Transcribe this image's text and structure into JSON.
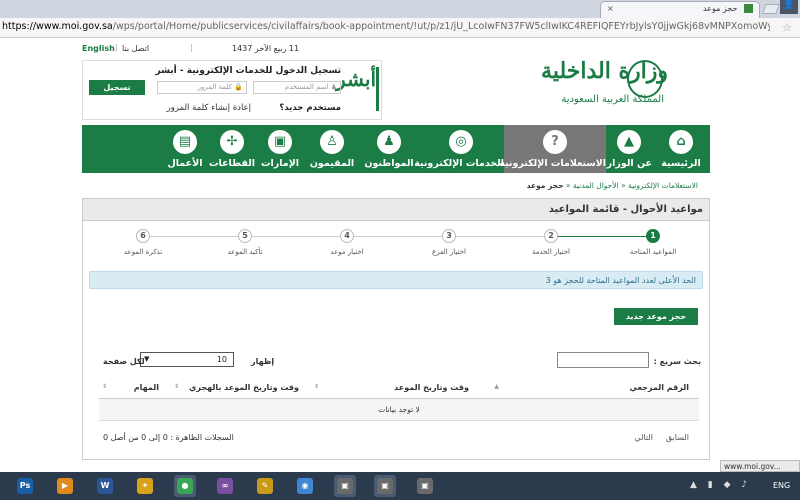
{
  "browser": {
    "tab_title": "حجز موعد",
    "tab_close": "×",
    "new_tab_button": "",
    "window_control": "👤",
    "url_domain": "https://www.moi.gov.sa",
    "url_path": "/wps/portal/Home/publicservices/civilaffairs/book-appointment/!ut/p/z1/jU_LcoIwFN37FW5clIwIKC4REFIQFEYrbJylsY0jjwGkj68vMNPXomoWycmc",
    "status_link": "www.moi.gov..."
  },
  "topbar": {
    "hijri_date": "11 ربيع الآخر 1437",
    "contact_link": "اتصل بنا",
    "english_link": "English"
  },
  "logo": {
    "title": "وزارة الداخلية",
    "subtitle": "المملكة العربية السعودية"
  },
  "login": {
    "absher_logo": "أبشر",
    "title": "تسجيل الدخول للخدمات الإلكترونية - أبشر",
    "username_placeholder": "اسم المستخدم",
    "password_placeholder": "كلمة المرور",
    "login_button": "تسجيل الدخول",
    "new_user_link": "مستخدم جديد؟",
    "reset_password_link": "إعادة إنشاء كلمة المرور"
  },
  "nav": {
    "items": [
      {
        "label": "الرئيسية",
        "icon": "home-icon",
        "glyph": "⌂"
      },
      {
        "label": "عن الوزارة",
        "icon": "ministry-icon",
        "glyph": "▲"
      },
      {
        "label": "الاستعلامات الإلكترونية",
        "icon": "inquiries-icon",
        "glyph": "?"
      },
      {
        "label": "الخدمات الإلكترونية",
        "icon": "globe-icon",
        "glyph": "◎"
      },
      {
        "label": "المواطنون",
        "icon": "citizen-icon",
        "glyph": "♟"
      },
      {
        "label": "المقيمون",
        "icon": "residents-icon",
        "glyph": "♙"
      },
      {
        "label": "الإمارات",
        "icon": "regions-icon",
        "glyph": "▣"
      },
      {
        "label": "القطاعات",
        "icon": "sectors-icon",
        "glyph": "✢"
      },
      {
        "label": "الأعمال",
        "icon": "business-icon",
        "glyph": "▤"
      }
    ]
  },
  "breadcrumb": {
    "item1": "الاستعلامات الإلكترونية",
    "item2": "الأحوال المدنية",
    "current": "حجز موعد",
    "sep": "«"
  },
  "panel": {
    "title": "مواعيد الأحوال - قائمة المواعيد",
    "steps": [
      {
        "num": "1",
        "label": "المواعيد المتاحة"
      },
      {
        "num": "2",
        "label": "اختيار الخدمة"
      },
      {
        "num": "3",
        "label": "اختيار الفرع"
      },
      {
        "num": "4",
        "label": "اختيار موعد"
      },
      {
        "num": "5",
        "label": "تأكيد الموعد"
      },
      {
        "num": "6",
        "label": "تذكرة الموعد"
      }
    ],
    "notice": "الحد الأعلى لعدد المواعيد المتاحة للحجز هو 3",
    "new_booking_button": "حجز موعد جديد",
    "quick_search_label": "بحث سريع :",
    "show_label": "إظهار",
    "page_size": "10",
    "per_page_label": "لكل صفحة",
    "columns": [
      "الرقم المرجعي",
      "وقت وتاريخ الموعد",
      "وقت وتاريخ الموعد بالهجري",
      "المهام"
    ],
    "empty_message": "لا توجد بيانات",
    "records_info": "السجلات الظاهرة : 0 إلى 0 من أصل 0",
    "next_label": "التالي",
    "prev_label": "السابق"
  },
  "taskbar": {
    "apps": [
      {
        "name": "photoshop-icon",
        "glyph": "Ps",
        "color": "#1b5ea8"
      },
      {
        "name": "media-player-icon",
        "glyph": "▶",
        "color": "#e08a1e"
      },
      {
        "name": "word-icon",
        "glyph": "W",
        "color": "#2b5797"
      },
      {
        "name": "bird-app-icon",
        "glyph": "✦",
        "color": "#d9a21b"
      },
      {
        "name": "chrome-icon",
        "glyph": "●",
        "color": "#3aa655"
      },
      {
        "name": "visual-studio-icon",
        "glyph": "∞",
        "color": "#7b4fa0"
      },
      {
        "name": "pen-tool-icon",
        "glyph": "✎",
        "color": "#c99a16"
      },
      {
        "name": "sphere-app-icon",
        "glyph": "◉",
        "color": "#3f87d1"
      },
      {
        "name": "screen-capture-icon",
        "glyph": "▣",
        "color": "#6a6a6a"
      },
      {
        "name": "screen-capture-2-icon",
        "glyph": "▣",
        "color": "#6a6a6a"
      },
      {
        "name": "screen-capture-3-icon",
        "glyph": "▣",
        "color": "#6a6a6a"
      }
    ],
    "language": "ENG"
  },
  "colors": {
    "brand_green": "#1b7c45",
    "active_nav": "#777777",
    "notice_bg": "#d9ecf4"
  }
}
